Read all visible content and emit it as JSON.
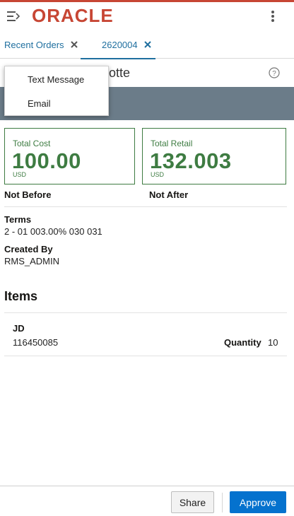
{
  "brand": {
    "logo_text": "ORACLE",
    "accent_color": "#c74634"
  },
  "header": {
    "menu_icon": "hamburger-menu-icon",
    "overflow_icon": "kebab-menu-icon"
  },
  "tabs": [
    {
      "label": "Recent Orders",
      "closable": true
    },
    {
      "label": "2620004",
      "closable": true,
      "active": true
    }
  ],
  "page": {
    "title_visible_fragment": "otte",
    "help_icon": "help-icon"
  },
  "share_menu": {
    "items": [
      "Text Message",
      "Email"
    ]
  },
  "cards": {
    "total_cost": {
      "label": "Total Cost",
      "value": "100.00",
      "unit": "USD"
    },
    "total_retail": {
      "label": "Total Retail",
      "value": "132.003",
      "unit": "USD"
    }
  },
  "dates": {
    "not_before_label": "Not Before",
    "not_after_label": "Not After"
  },
  "details": {
    "terms_label": "Terms",
    "terms_value": "2 - 01 003.00% 030 031",
    "created_by_label": "Created By",
    "created_by_value": "RMS_ADMIN"
  },
  "items_section": {
    "title": "Items",
    "items": [
      {
        "name": "JD",
        "number": "116450085",
        "quantity_label": "Quantity",
        "quantity": "10"
      }
    ]
  },
  "footer": {
    "share_label": "Share",
    "approve_label": "Approve",
    "approve_color": "#0572ce"
  }
}
